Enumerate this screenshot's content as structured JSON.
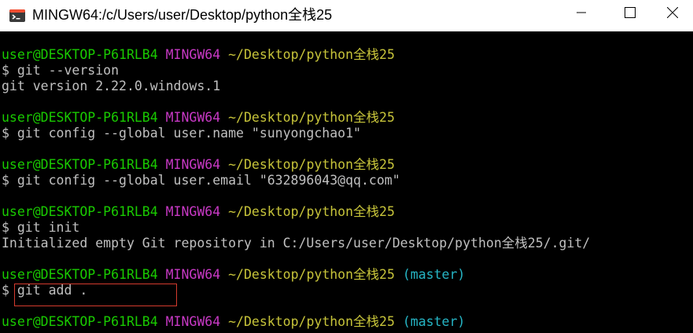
{
  "window": {
    "title": "MINGW64:/c/Users/user/Desktop/python全栈25",
    "icon": "git-bash-icon",
    "controls": {
      "minimize_icon": "minimize-icon",
      "maximize_icon": "maximize-icon",
      "close_icon": "close-icon"
    }
  },
  "colors": {
    "user_host": "#19cb00",
    "system": "#c839c5",
    "path": "#c7c43a",
    "branch": "#26b6c6",
    "output": "#c0c0c0",
    "highlight_border": "#d43b2e"
  },
  "terminal": {
    "prompt_user": "user@DESKTOP-P61RLB4",
    "prompt_system": "MINGW64",
    "prompt_path": "~/Desktop/python全栈25",
    "prompt_branch": "(master)",
    "blocks": [
      {
        "command": "$ git --version",
        "output": "git version 2.22.0.windows.1"
      },
      {
        "command": "$ git config --global user.name \"sunyongchao1\""
      },
      {
        "command": "$ git config --global user.email \"632896043@qq.com\""
      },
      {
        "command": "$ git init",
        "output": "Initialized empty Git repository in C:/Users/user/Desktop/python全栈25/.git/"
      },
      {
        "command": "$ git add ."
      }
    ]
  }
}
